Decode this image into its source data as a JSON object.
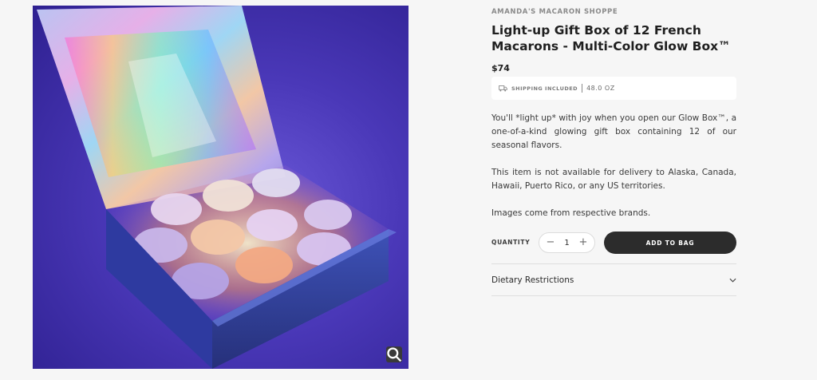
{
  "product": {
    "vendor": "AMANDA'S MACARON SHOPPE",
    "title": "Light-up Gift Box of 12 French Macarons - Multi-Color Glow Box™",
    "price": "$74",
    "shipping_label": "SHIPPING INCLUDED",
    "weight": "48.0 OZ",
    "description": [
      "You'll *light up* with joy when you open our Glow Box™, a one-of-a-kind glowing gift box containing 12 of our seasonal flavors.",
      "This item is not available for delivery to Alaska, Canada, Hawaii, Puerto Rico, or any US territories.",
      "Images come from respective brands."
    ]
  },
  "purchase": {
    "quantity_label": "QUANTITY",
    "quantity_value": "1",
    "minus_symbol": "−",
    "plus_symbol": "+",
    "add_to_bag_label": "ADD TO BAG"
  },
  "accordion": {
    "dietary_label": "Dietary Restrictions"
  },
  "icons": {
    "shipping": "truck-icon",
    "zoom": "zoom-icon",
    "accordion": "chevron-down-icon"
  },
  "colors": {
    "button_dark": "#2c2c2c",
    "page_bg": "#f6f6f6",
    "box_glow_purple": "#4a38b8"
  }
}
